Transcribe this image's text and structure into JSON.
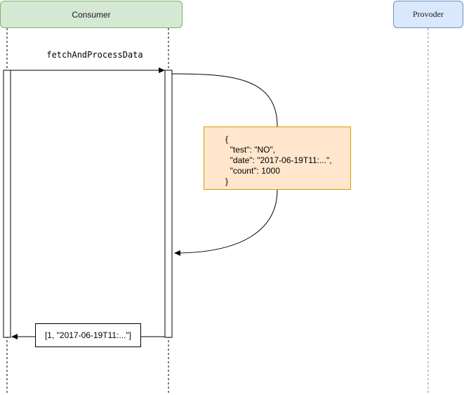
{
  "participants": {
    "consumer": {
      "label": "Consumer",
      "fill": "#d5e8d4",
      "stroke": "#82b366"
    },
    "provider": {
      "label": "Provoder",
      "fill": "#dae8fc",
      "stroke": "#6c8ebf"
    }
  },
  "call_message": {
    "label": "fetchAndProcessData"
  },
  "note": {
    "lines": [
      "{",
      "  \"test\": \"NO\",",
      "  \"date\": \"2017-06-19T11:...\",",
      "  \"count\": 1000",
      "}"
    ],
    "fill": "#ffe6cc",
    "stroke": "#d79b00"
  },
  "return_message": {
    "label": "[1, \"2017-06-19T11:...\"]"
  }
}
